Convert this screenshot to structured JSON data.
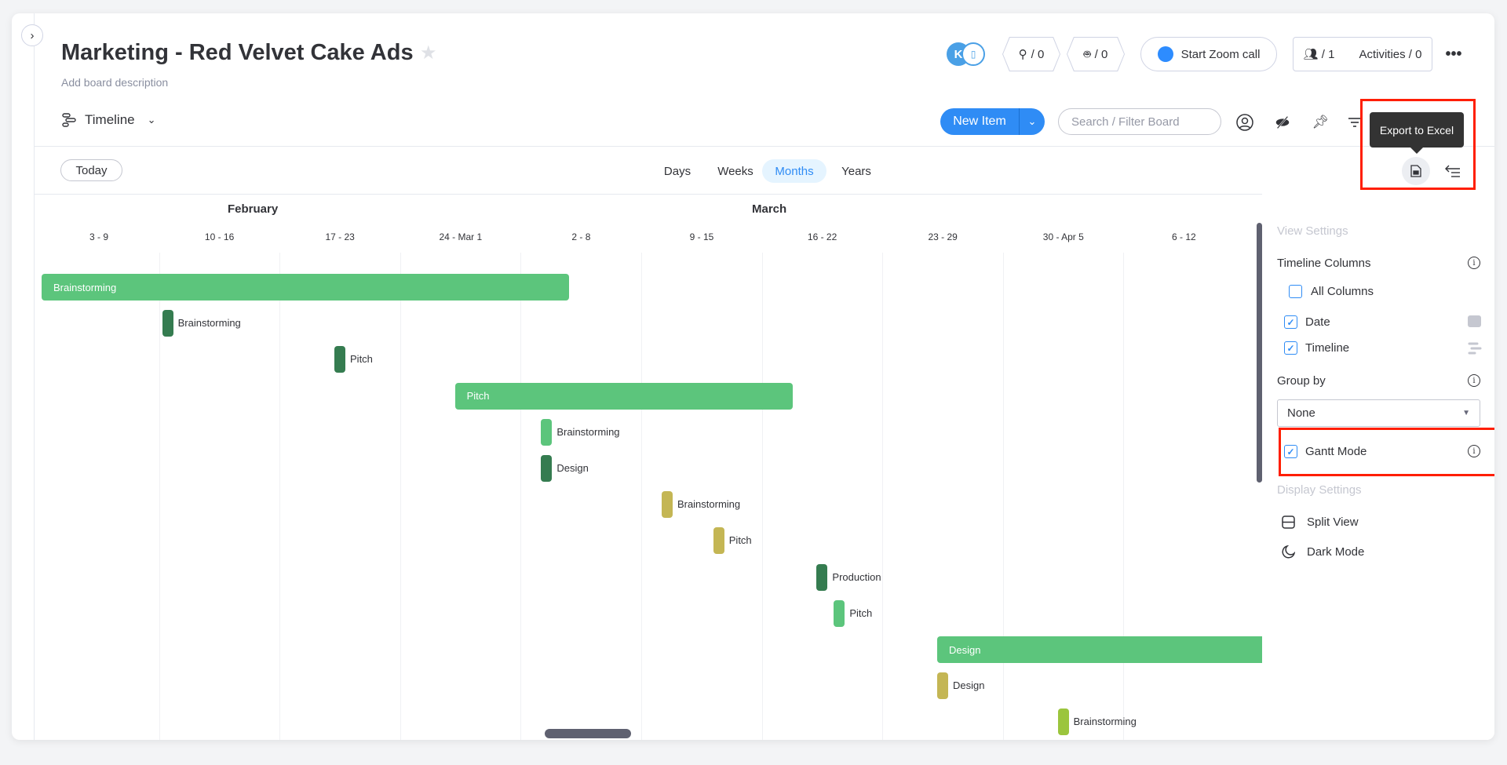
{
  "board": {
    "title": "Marketing - Red Velvet Cake Ads",
    "description": "Add board description",
    "view": "Timeline",
    "star_icon": "star-icon"
  },
  "header": {
    "avatar_initial": "K",
    "integrations_count": "/ 0",
    "automations_count": "/ 0",
    "zoom_label": "Start Zoom call",
    "members_count": "/ 1",
    "activities_label": "Activities / 0",
    "more_icon": "more-dots-icon"
  },
  "toolbar": {
    "new_item": "New Item",
    "search_placeholder": "Search / Filter Board",
    "tooltip": "Export to Excel"
  },
  "timeline": {
    "today": "Today",
    "scales": [
      "Days",
      "Weeks",
      "Months",
      "Years"
    ],
    "active_scale": "Months",
    "months": [
      "February",
      "March"
    ],
    "weeks": [
      "3 - 9",
      "10 - 16",
      "17 - 23",
      "24 - Mar 1",
      "2 - 8",
      "9 - 15",
      "16 - 22",
      "23 - 29",
      "30 - Apr 5",
      "6 - 12"
    ],
    "colors": {
      "light_green": "#5cc57c",
      "dark_green": "#357c50",
      "olive": "#c4b654",
      "lime": "#9bc53d"
    },
    "items": [
      {
        "label": "Brainstorming",
        "start": "Feb 3",
        "end": "Mar 4",
        "color": "light_green",
        "type": "bar"
      },
      {
        "label": "Brainstorming",
        "start": "Feb 10",
        "end": "Feb 10",
        "color": "dark_green",
        "type": "milestone"
      },
      {
        "label": "Pitch",
        "start": "Feb 20",
        "end": "Feb 20",
        "color": "dark_green",
        "type": "milestone"
      },
      {
        "label": "Pitch",
        "start": "Feb 27",
        "end": "Mar 17",
        "color": "light_green",
        "type": "bar"
      },
      {
        "label": "Brainstorming",
        "start": "Mar 3",
        "end": "Mar 3",
        "color": "light_green",
        "type": "milestone"
      },
      {
        "label": "Design",
        "start": "Mar 3",
        "end": "Mar 3",
        "color": "dark_green",
        "type": "milestone"
      },
      {
        "label": "Brainstorming",
        "start": "Mar 10",
        "end": "Mar 10",
        "color": "olive",
        "type": "milestone"
      },
      {
        "label": "Pitch",
        "start": "Mar 13",
        "end": "Mar 13",
        "color": "olive",
        "type": "milestone"
      },
      {
        "label": "Production",
        "start": "Mar 19",
        "end": "Mar 19",
        "color": "dark_green",
        "type": "milestone"
      },
      {
        "label": "Pitch",
        "start": "Mar 20",
        "end": "Mar 20",
        "color": "light_green",
        "type": "milestone"
      },
      {
        "label": "Design",
        "start": "Mar 26",
        "end": null,
        "color": "light_green",
        "type": "bar"
      },
      {
        "label": "Design",
        "start": "Mar 26",
        "end": "Mar 26",
        "color": "olive",
        "type": "milestone"
      },
      {
        "label": "Brainstorming",
        "start": "Apr 2",
        "end": "Apr 2",
        "color": "lime",
        "type": "milestone"
      }
    ]
  },
  "settings": {
    "view_settings": "View Settings",
    "timeline_columns": "Timeline Columns",
    "all_columns": {
      "label": "All Columns",
      "checked": false
    },
    "date": {
      "label": "Date",
      "checked": true
    },
    "timeline": {
      "label": "Timeline",
      "checked": true
    },
    "group_by": "Group by",
    "group_by_value": "None",
    "gantt_mode": {
      "label": "Gantt Mode",
      "checked": true
    },
    "display_settings": "Display Settings",
    "split_view": "Split View",
    "dark_mode": "Dark Mode"
  }
}
